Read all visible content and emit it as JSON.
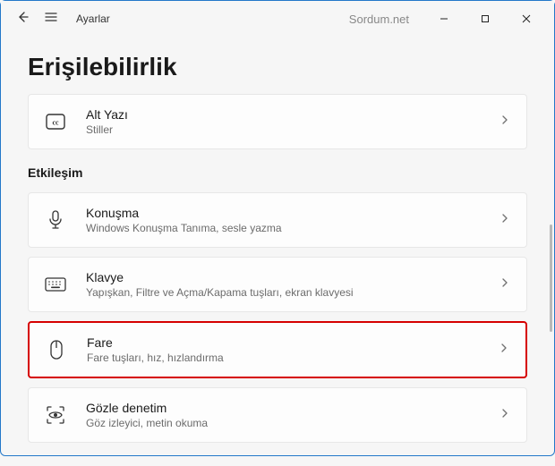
{
  "titlebar": {
    "app_title": "Ayarlar",
    "watermark": "Sordum.net"
  },
  "page_title": "Erişilebilirlik",
  "top_card": {
    "title": "Alt Yazı",
    "subtitle": "Stiller"
  },
  "section_header": "Etkileşim",
  "items": [
    {
      "title": "Konuşma",
      "subtitle": "Windows Konuşma Tanıma, sesle yazma"
    },
    {
      "title": "Klavye",
      "subtitle": "Yapışkan, Filtre ve Açma/Kapama tuşları, ekran klavyesi"
    },
    {
      "title": "Fare",
      "subtitle": "Fare tuşları, hız, hızlandırma"
    },
    {
      "title": "Gözle denetim",
      "subtitle": "Göz izleyici, metin okuma"
    }
  ]
}
